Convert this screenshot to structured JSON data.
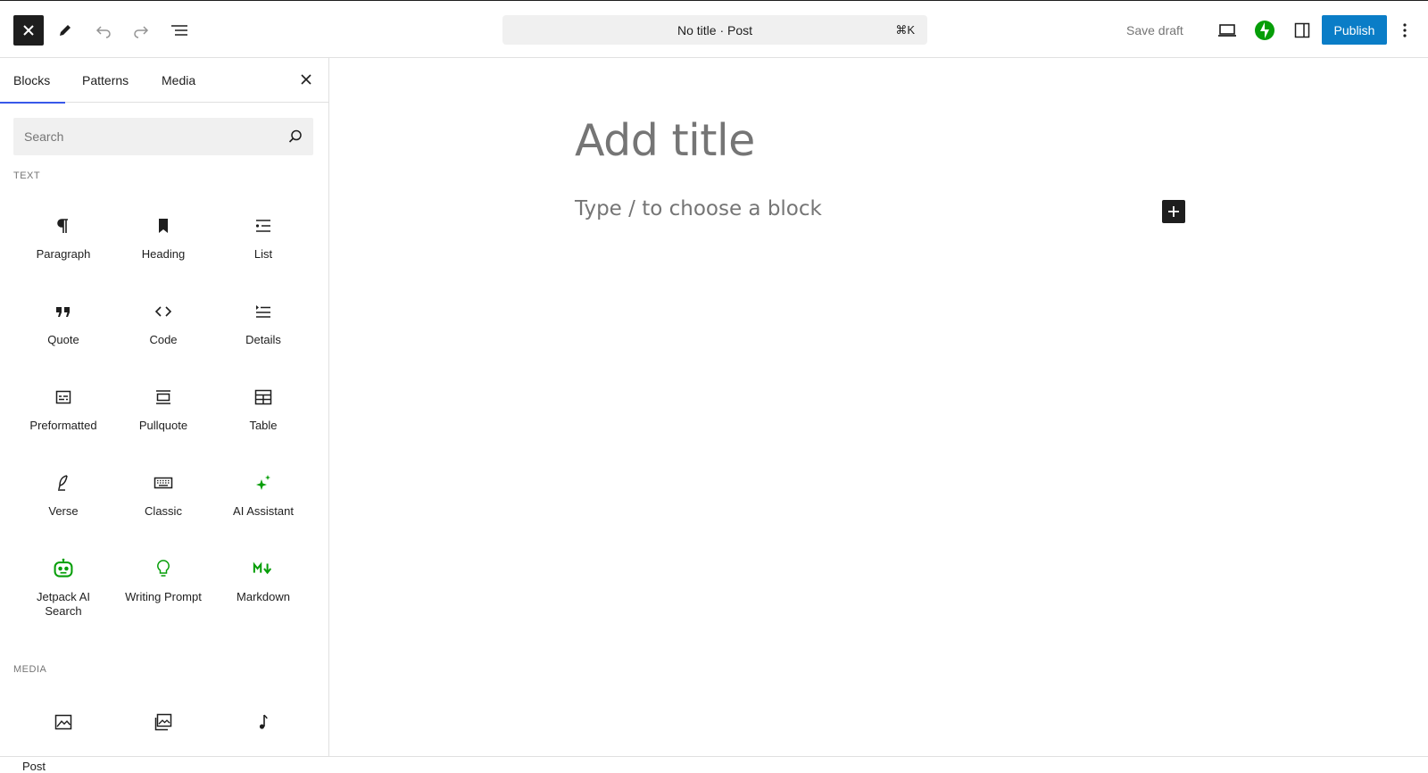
{
  "header": {
    "document_title": "No title · Post",
    "shortcut": "⌘K",
    "save_draft_label": "Save draft",
    "publish_label": "Publish",
    "colors": {
      "publish": "#0a7dc7",
      "jetpack": "#069e08",
      "accent": "#3858e9"
    }
  },
  "sidebar": {
    "tabs": [
      {
        "label": "Blocks",
        "active": true
      },
      {
        "label": "Patterns",
        "active": false
      },
      {
        "label": "Media",
        "active": false
      }
    ],
    "search_placeholder": "Search",
    "sections": [
      {
        "title": "TEXT",
        "blocks": [
          {
            "label": "Paragraph",
            "icon": "paragraph-icon"
          },
          {
            "label": "Heading",
            "icon": "heading-icon"
          },
          {
            "label": "List",
            "icon": "list-icon"
          },
          {
            "label": "Quote",
            "icon": "quote-icon"
          },
          {
            "label": "Code",
            "icon": "code-icon"
          },
          {
            "label": "Details",
            "icon": "details-icon"
          },
          {
            "label": "Preformatted",
            "icon": "preformatted-icon"
          },
          {
            "label": "Pullquote",
            "icon": "pullquote-icon"
          },
          {
            "label": "Table",
            "icon": "table-icon"
          },
          {
            "label": "Verse",
            "icon": "verse-icon"
          },
          {
            "label": "Classic",
            "icon": "classic-icon"
          },
          {
            "label": "AI Assistant",
            "icon": "ai-sparkle-icon"
          },
          {
            "label": "Jetpack AI Search",
            "icon": "robot-icon"
          },
          {
            "label": "Writing Prompt",
            "icon": "lightbulb-icon"
          },
          {
            "label": "Markdown",
            "icon": "markdown-icon"
          }
        ]
      },
      {
        "title": "MEDIA",
        "blocks": [
          {
            "label": "",
            "icon": "image-icon"
          },
          {
            "label": "",
            "icon": "gallery-icon"
          },
          {
            "label": "",
            "icon": "audio-icon"
          }
        ]
      }
    ]
  },
  "editor": {
    "title_placeholder": "Add title",
    "block_placeholder": "Type / to choose a block"
  },
  "footer": {
    "breadcrumb": "Post"
  }
}
